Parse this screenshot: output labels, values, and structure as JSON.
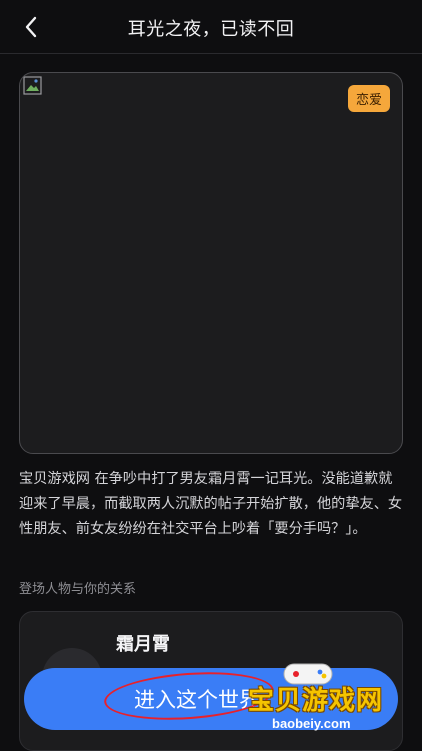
{
  "header": {
    "title": "耳光之夜，已读不回",
    "back_icon": "chevron-left-icon"
  },
  "cover": {
    "tag": "恋爱",
    "image_icon": "broken-image-icon"
  },
  "description": "宝贝游戏网 在争吵中打了男友霜月霄一记耳光。没能道歉就迎来了早晨，而截取两人沉默的帖子开始扩散，他的挚友、女性朋友、前女友纷纷在社交平台上吵着「要分手吗？」。",
  "characters_section": {
    "label": "登场人物与你的关系",
    "characters": [
      {
        "name": "霜月霄"
      }
    ]
  },
  "enter_button": {
    "label": "进入这个世界"
  },
  "watermark": {
    "text": "宝贝游戏网",
    "url": "baobeiy.com"
  },
  "colors": {
    "accent": "#3a7df6",
    "tag_bg": "#f5a73b",
    "annotation": "#e8212b",
    "watermark": "#f5c400"
  }
}
